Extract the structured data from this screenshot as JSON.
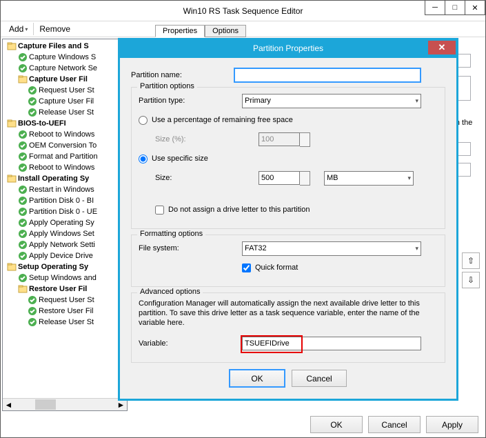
{
  "window": {
    "title": "Win10 RS Task Sequence Editor",
    "min_label": "─",
    "max_label": "□",
    "close_label": "✕"
  },
  "toolbar": {
    "add_label": "Add",
    "remove_label": "Remove"
  },
  "tabs": {
    "properties": "Properties",
    "options": "Options"
  },
  "tree": {
    "n0": "Capture Files and S",
    "n0a": "Capture Windows S",
    "n0b": "Capture Network Se",
    "n1": "Capture User Fil",
    "n1a": "Request User St",
    "n1b": "Capture User Fil",
    "n1c": "Release User St",
    "n2": "BIOS-to-UEFI",
    "n2a": "Reboot to Windows",
    "n2b": "OEM Conversion To",
    "n2c": "Format and Partition",
    "n2d": "Reboot to Windows",
    "n3": "Install Operating Sy",
    "n3a": "Restart in Windows",
    "n3b": "Partition Disk 0 - BI",
    "n3c": "Partition Disk 0 - UE",
    "n3d": "Apply Operating Sy",
    "n3e": "Apply Windows Set",
    "n3f": "Apply Network Setti",
    "n3g": "Apply Device Drive",
    "n4": "Setup Operating Sy",
    "n4a": "Setup Windows and",
    "n5": "Restore User Fil",
    "n5a": "Request User St",
    "n5b": "Restore User Fil",
    "n5c": "Release User St"
  },
  "right_panel": {
    "layout_text": "layout to use in the"
  },
  "dialog": {
    "title": "Partition Properties",
    "partition_name_label": "Partition name:",
    "partition_name_value": "",
    "options_legend": "Partition options",
    "partition_type_label": "Partition type:",
    "partition_type_value": "Primary",
    "use_percentage_label": "Use a percentage of remaining free space",
    "size_percent_label": "Size (%):",
    "size_percent_value": "100",
    "use_specific_label": "Use specific size",
    "size_label": "Size:",
    "size_value": "500",
    "size_unit": "MB",
    "no_drive_letter_label": "Do not assign a drive letter to this partition",
    "formatting_legend": "Formatting options",
    "filesystem_label": "File system:",
    "filesystem_value": "FAT32",
    "quick_format_label": "Quick format",
    "advanced_legend": "Advanced options",
    "advanced_help": "Configuration Manager will automatically assign the next available drive letter to this partition. To save this drive letter as a task sequence variable, enter the name of the variable here.",
    "variable_label": "Variable:",
    "variable_value": "TSUEFIDrive",
    "ok_label": "OK",
    "cancel_label": "Cancel"
  },
  "footer": {
    "ok_label": "OK",
    "cancel_label": "Cancel",
    "apply_label": "Apply"
  }
}
